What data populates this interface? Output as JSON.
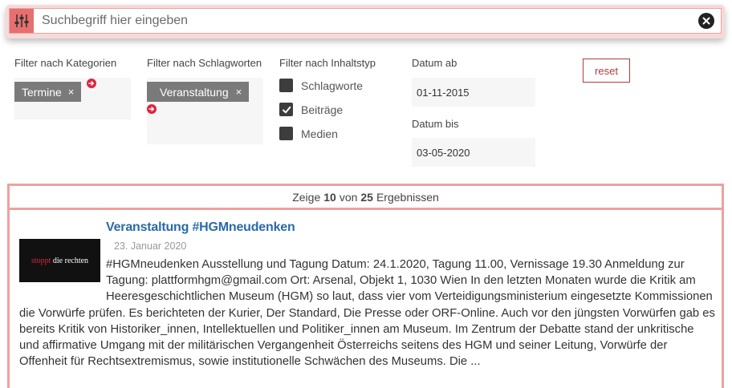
{
  "search": {
    "placeholder": "Suchbegriff hier eingeben",
    "value": ""
  },
  "filters": {
    "categories_label": "Filter nach Kategorien",
    "categories_tags": [
      "Termine"
    ],
    "keywords_label": "Filter nach Schlagworten",
    "keywords_tags": [
      "Veranstaltung"
    ],
    "content_type_label": "Filter nach Inhaltstyp",
    "content_types": [
      {
        "label": "Schlagworte",
        "checked": false
      },
      {
        "label": "Beiträge",
        "checked": true
      },
      {
        "label": "Medien",
        "checked": false
      }
    ],
    "date_from_label": "Datum ab",
    "date_from_value": "01-11-2015",
    "date_to_label": "Datum bis",
    "date_to_value": "03-05-2020",
    "reset_label": "reset",
    "remove_symbol": "×"
  },
  "results": {
    "count_prefix": "Zeige",
    "count_shown": "10",
    "count_mid": "von",
    "count_total": "25",
    "count_suffix": "Ergebnissen",
    "items": [
      {
        "title": "Veranstaltung #HGMneudenken",
        "date": "23. Januar 2020",
        "thumb_text_red": "stoppt",
        "thumb_text_white": "die rechten",
        "excerpt": "#HGMneudenken Ausstellung und Tagung Datum: 24.1.2020, Tagung 11.00, Vernissage 19.30 Anmeldung zur Tagung: plattformhgm@gmail.com Ort: Arsenal, Objekt 1, 1030 Wien In den letzten Monaten wurde die Kritik am Heeresgeschichtlichen Museum (HGM) so laut, dass vier vom Verteidigungsministerium eingesetzte Kommissionen die Vorwürfe prüfen. Es berichteten der Kurier, Der Standard, Die Presse oder ORF-Online. Auch vor den jüngsten Vorwürfen gab es bereits Kritik von Historiker_innen, Intellektuellen und Politiker_innen am Museum. Im Zentrum der Debatte stand der unkritische und affirmative Umgang mit der militärischen Vergangenheit Österreichs seitens des HGM und seiner Leitung, Vorwürfe der Offenheit für Rechtsextremismus, sowie institutionelle Schwächen des Museums. Die ..."
      }
    ]
  },
  "colors": {
    "accent": "#e76f6f",
    "border": "#f0a0a0",
    "link": "#2a6aa8",
    "reset": "#b43a3a",
    "arrow": "#e0243b"
  },
  "icons": {
    "filter_toggle": "sliders-icon",
    "clear": "close-circle-icon",
    "add_filter": "arrow-right-circle-icon",
    "checkbox_checked": "checkmark-icon"
  }
}
